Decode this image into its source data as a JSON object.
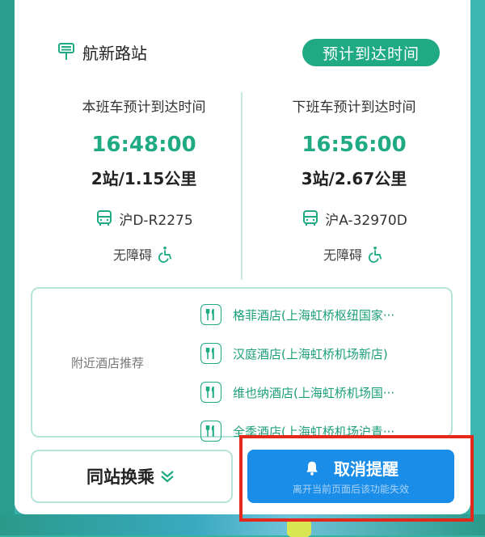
{
  "station": {
    "name": "航新路站",
    "eta_badge": "预计到达时间"
  },
  "current_bus": {
    "caption": "本班车预计到达时间",
    "time": "16:48:00",
    "distance": "2站/1.15公里",
    "plate": "沪D-R2275",
    "accessibility": "无障碍"
  },
  "next_bus": {
    "caption": "下班车预计到达时间",
    "time": "16:56:00",
    "distance": "3站/2.67公里",
    "plate": "沪A-32970D",
    "accessibility": "无障碍"
  },
  "hotels": {
    "title": "附近酒店推荐",
    "items": [
      "格菲酒店(上海虹桥枢纽国家···",
      "汉庭酒店(上海虹桥机场新店)",
      "维也纳酒店(上海虹桥机场国···",
      "全季酒店(上海虹桥机场沪青···"
    ]
  },
  "actions": {
    "transfer_label": "同站换乘",
    "cancel_label": "取消提醒",
    "cancel_sub": "离开当前页面后该功能失效"
  },
  "colors": {
    "accent": "#1faa83",
    "button_blue": "#1a8de8",
    "highlight": "#e5281c"
  },
  "icons": {
    "station": "bus-stop-icon",
    "bus": "bus-icon",
    "accessibility": "wheelchair-icon",
    "hotel": "fork-knife-icon",
    "chevron": "chevron-double-down-icon",
    "bell": "bell-icon"
  }
}
